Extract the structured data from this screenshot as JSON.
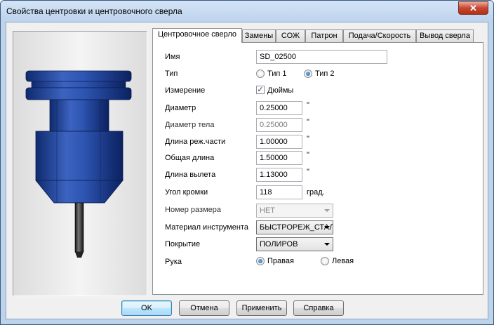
{
  "window": {
    "title": "Свойства центровки и центровочного сверла",
    "close_glyph": "✕"
  },
  "tabs": [
    {
      "label": "Центровочное сверло",
      "active": true
    },
    {
      "label": "Замены"
    },
    {
      "label": "СОЖ"
    },
    {
      "label": "Патрон"
    },
    {
      "label": "Подача/Скорость"
    },
    {
      "label": "Вывод сверла"
    }
  ],
  "form": {
    "name": {
      "label": "Имя",
      "value": "SD_02500"
    },
    "type": {
      "label": "Тип",
      "option1": "Тип 1",
      "option2": "Тип 2",
      "selected": "Тип 2"
    },
    "measurement": {
      "label": "Измерение",
      "checkbox_label": "Дюймы",
      "checked": true
    },
    "diameter": {
      "label": "Диаметр",
      "value": "0.25000",
      "unit": "\""
    },
    "body_diameter": {
      "label": "Диаметр тела",
      "value": "0.25000",
      "unit": "\""
    },
    "cut_length": {
      "label": "Длина реж.части",
      "value": "1.00000",
      "unit": "\""
    },
    "total_length": {
      "label": "Общая длина",
      "value": "1.50000",
      "unit": "\""
    },
    "overhang_length": {
      "label": "Длина вылета",
      "value": "1.13000",
      "unit": "\""
    },
    "edge_angle": {
      "label": "Угол кромки",
      "value": "118",
      "unit": "град."
    },
    "size_number": {
      "label": "Номер размера",
      "value": "НЕТ"
    },
    "tool_material": {
      "label": "Материал инструмента",
      "value": "БЫСТРОРЕЖ_СТАЛЬ"
    },
    "coating": {
      "label": "Покрытие",
      "value": "ПОЛИРОВ"
    },
    "hand": {
      "label": "Рука",
      "option1": "Правая",
      "option2": "Левая",
      "selected": "Правая"
    }
  },
  "buttons": {
    "ok": "OK",
    "cancel": "Отмена",
    "apply": "Применить",
    "help": "Справка"
  },
  "colors": {
    "tool_blue": "#2b4fa8",
    "title_bar": "#c9dcf1",
    "close_red": "#c7462f"
  },
  "icons": {
    "close": "close-icon",
    "tool_preview": "center-drill-tool-image",
    "dropdown": "chevron-down-icon"
  }
}
